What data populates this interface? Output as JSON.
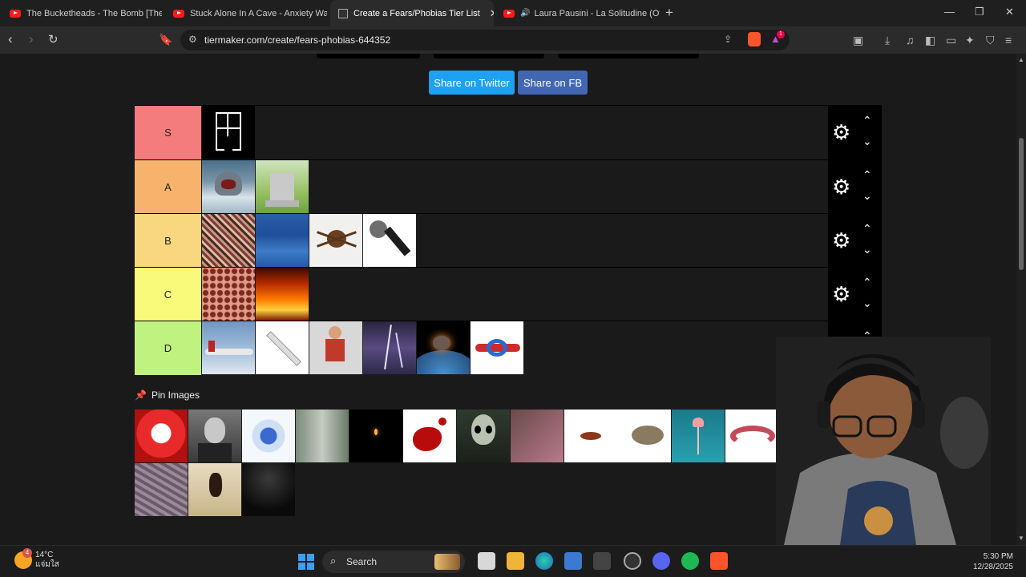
{
  "browser": {
    "tabs": [
      {
        "title": "The Bucketheads - The Bomb [These",
        "icon": "youtube-icon",
        "active": false
      },
      {
        "title": "Stuck Alone In A Cave - Anxiety Warr",
        "icon": "youtube-icon",
        "active": false
      },
      {
        "title": "Create a Fears/Phobias Tier List",
        "icon": "tiermaker-icon",
        "active": true
      },
      {
        "title": "Laura Pausini - La Solitudine (Offi",
        "icon": "youtube-icon",
        "active": false
      }
    ],
    "new_tab": "+",
    "url": "tiermaker.com/create/fears-phobias-644352",
    "brave_badge": "1"
  },
  "share": {
    "twitter": "Share on Twitter",
    "facebook": "Share on FB"
  },
  "tiers": [
    {
      "label": "S",
      "color": "#f47c7c",
      "items": [
        "window-figure"
      ]
    },
    {
      "label": "A",
      "color": "#f7b26c",
      "items": [
        "shark",
        "gravestone"
      ]
    },
    {
      "label": "B",
      "color": "#f9d77e",
      "items": [
        "crowd",
        "ocean",
        "spider",
        "microphone"
      ]
    },
    {
      "label": "C",
      "color": "#fafa7a",
      "items": [
        "holes-trypophobia",
        "fire"
      ]
    },
    {
      "label": "D",
      "color": "#bff27e",
      "items": [
        "airplane",
        "syringe",
        "puppet",
        "lightning",
        "asteroid",
        "knot"
      ]
    }
  ],
  "pin": {
    "label": "Pin Images"
  },
  "pool": [
    "clown",
    "man-portrait",
    "virus",
    "heights",
    "darkness-candle",
    "blood",
    "alien",
    "scared-girl",
    "cockroach-mouse",
    "jellyfish",
    "worm",
    "yellow-partial",
    "centipede",
    "scorpion-hand",
    "dark-room"
  ],
  "taskbar": {
    "weather": {
      "temp": "14°C",
      "desc": "แจ่มใส",
      "badge": "4"
    },
    "search": "Search",
    "time": "5:30 PM",
    "date": "12/28/2025"
  }
}
